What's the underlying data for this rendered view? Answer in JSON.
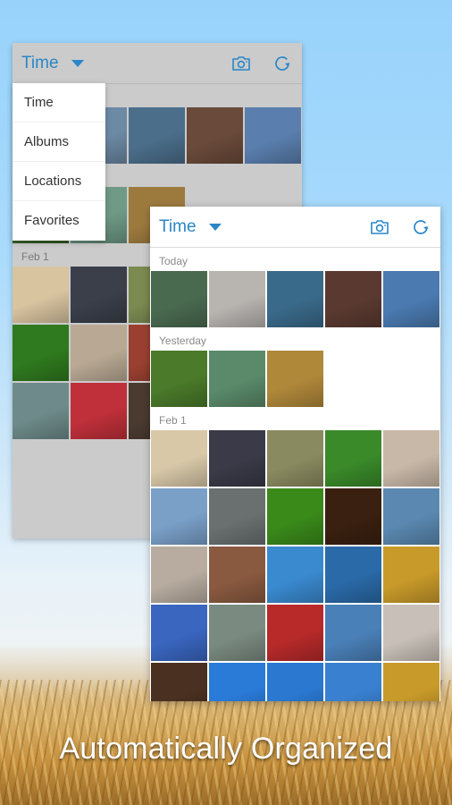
{
  "tagline": "Automatically Organized",
  "colors": {
    "accent": "#2a86c8",
    "section_label": "#8a8a8a",
    "menu_text": "#333333"
  },
  "back_panel": {
    "toolbar": {
      "title": "Time",
      "caret_icon": "triangle-down-icon",
      "camera_icon": "camera-icon",
      "refresh_icon": "refresh-icon"
    },
    "sections": [
      {
        "label": "",
        "thumbs": [
          "#b9c2c8",
          "#6d8aa5",
          "#4b6e8a",
          "#6a4a3a",
          "#5a7fae"
        ]
      },
      {
        "label": "",
        "thumbs": [
          "#3d6b2c",
          "#6f9a86",
          "#9c7a3e"
        ]
      },
      {
        "label": "Feb 1",
        "thumbs": [
          "#d9c4a0",
          "#3a3f4a",
          "#7a8a50",
          "#6a9a3a",
          "#5a6a6a",
          "#2f7a1e",
          "#b9a994",
          "#9a4030",
          "#3f74c4",
          "#3a66b0",
          "#6e8a8a",
          "#c0303a",
          "#4a3a30",
          "#2a7ad0",
          "#2a6ac0"
        ]
      }
    ]
  },
  "dropdown": {
    "items": [
      "Time",
      "Albums",
      "Locations",
      "Favorites"
    ]
  },
  "front_panel": {
    "toolbar": {
      "title": "Time",
      "caret_icon": "triangle-down-icon",
      "camera_icon": "camera-icon",
      "refresh_icon": "refresh-icon"
    },
    "sections": [
      {
        "label": "Today",
        "thumbs": [
          "#4a6a50",
          "#b8b4b0",
          "#3a6a8a",
          "#5a3a30",
          "#4a7ab0"
        ]
      },
      {
        "label": "Yesterday",
        "thumbs": [
          "#4a7a2a",
          "#5a8a6a",
          "#b0883a"
        ]
      },
      {
        "label": "Feb 1",
        "thumbs": [
          "#d8c8a8",
          "#3a3a48",
          "#8a8a60",
          "#3a8a2a",
          "#c8b8a8",
          "#7aa0c8",
          "#6a7070",
          "#3a8a1a",
          "#3a2010",
          "#5a88b0",
          "#b8aca0",
          "#8a5a40",
          "#3a8ad0",
          "#2a6aa8",
          "#c89a2a",
          "#3a66c0",
          "#7a8a80",
          "#b82a2a",
          "#4a80b8",
          "#c8c0b8",
          "#4a3020",
          "#2a7ad8",
          "#2a78d0",
          "#3a80d0",
          "#c89a2a"
        ]
      }
    ]
  }
}
